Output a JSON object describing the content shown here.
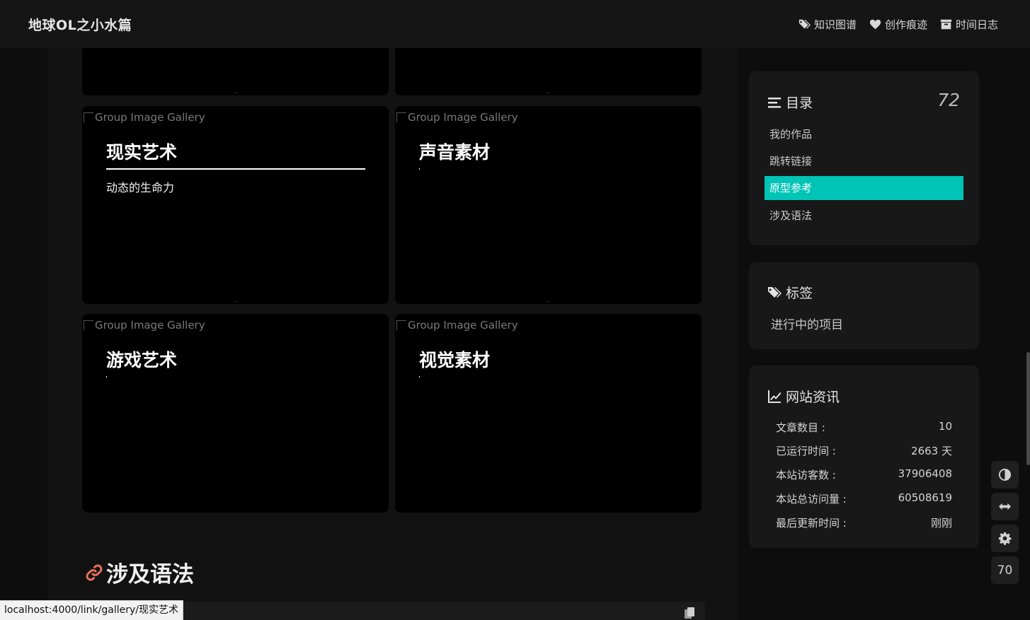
{
  "header": {
    "site_title": "地球OL之小水篇",
    "nav": [
      {
        "label": "知识图谱",
        "icon": "tags-icon"
      },
      {
        "label": "创作痕迹",
        "icon": "heart-icon"
      },
      {
        "label": "时间日志",
        "icon": "archive-icon"
      }
    ]
  },
  "gallery": {
    "alt_text": "Group Image Gallery",
    "cards": [
      {
        "title": "现实艺术",
        "desc": "动态的生命力"
      },
      {
        "title": "声音素材",
        "desc": ""
      },
      {
        "title": "游戏艺术",
        "desc": ""
      },
      {
        "title": "视觉素材",
        "desc": ""
      }
    ]
  },
  "section": {
    "heading": "涉及语法",
    "icon": "link-icon"
  },
  "status_url": "localhost:4000/link/gallery/现实艺术",
  "sidebar": {
    "toc": {
      "title": "目录",
      "count": "72",
      "items": [
        {
          "label": "我的作品",
          "active": false
        },
        {
          "label": "跳转链接",
          "active": false
        },
        {
          "label": "原型参考",
          "active": true
        },
        {
          "label": "涉及语法",
          "active": false
        }
      ]
    },
    "tags": {
      "title": "标签",
      "items": [
        "进行中的项目"
      ]
    },
    "info": {
      "title": "网站资讯",
      "rows": [
        {
          "label": "文章数目 :",
          "value": "10"
        },
        {
          "label": "已运行时间 :",
          "value": "2663 天"
        },
        {
          "label": "本站访客数 :",
          "value": "37906408"
        },
        {
          "label": "本站总访问量 :",
          "value": "60508619"
        },
        {
          "label": "最后更新时间 :",
          "value": "刚刚"
        }
      ]
    }
  },
  "right_buttons": {
    "scroll_percent": "70"
  },
  "colors": {
    "accent": "#00c4b6",
    "link_icon": "#e8705a"
  }
}
